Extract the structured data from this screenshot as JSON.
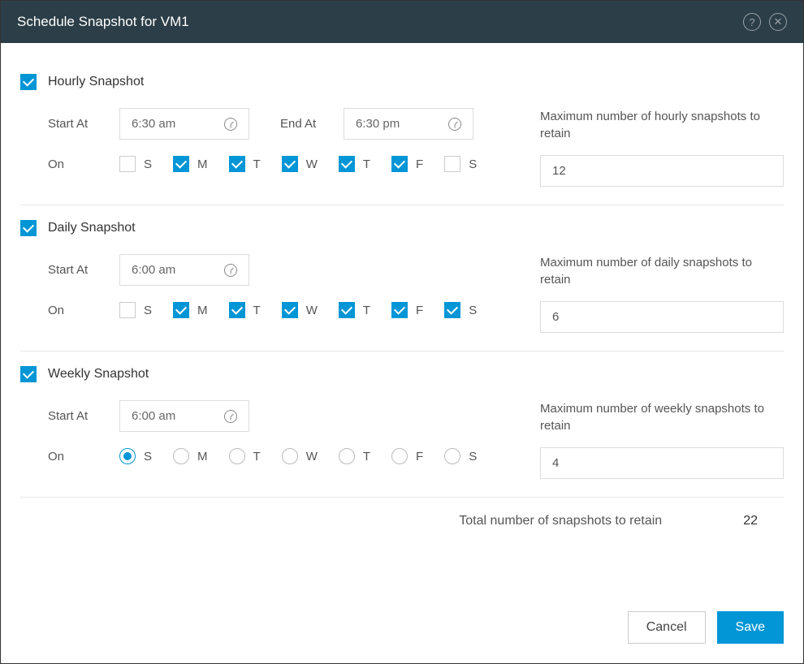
{
  "title": "Schedule Snapshot for VM1",
  "help_icon_char": "?",
  "close_icon_char": "✕",
  "labels": {
    "start_at": "Start At",
    "end_at": "End At",
    "on": "On",
    "total": "Total number of snapshots to retain",
    "cancel": "Cancel",
    "save": "Save"
  },
  "day_letters": [
    "S",
    "M",
    "T",
    "W",
    "T",
    "F",
    "S"
  ],
  "hourly": {
    "enabled": true,
    "title": "Hourly Snapshot",
    "start": "6:30 am",
    "end": "6:30 pm",
    "days": [
      false,
      true,
      true,
      true,
      true,
      true,
      false
    ],
    "retain_label": "Maximum number of hourly snapshots to retain",
    "retain": "12"
  },
  "daily": {
    "enabled": true,
    "title": "Daily Snapshot",
    "start": "6:00 am",
    "days": [
      false,
      true,
      true,
      true,
      true,
      true,
      true
    ],
    "retain_label": "Maximum number of daily snapshots to retain",
    "retain": "6"
  },
  "weekly": {
    "enabled": true,
    "title": "Weekly Snapshot",
    "start": "6:00 am",
    "day_selected": 0,
    "retain_label": "Maximum number of weekly snapshots to retain",
    "retain": "4"
  },
  "total": "22"
}
